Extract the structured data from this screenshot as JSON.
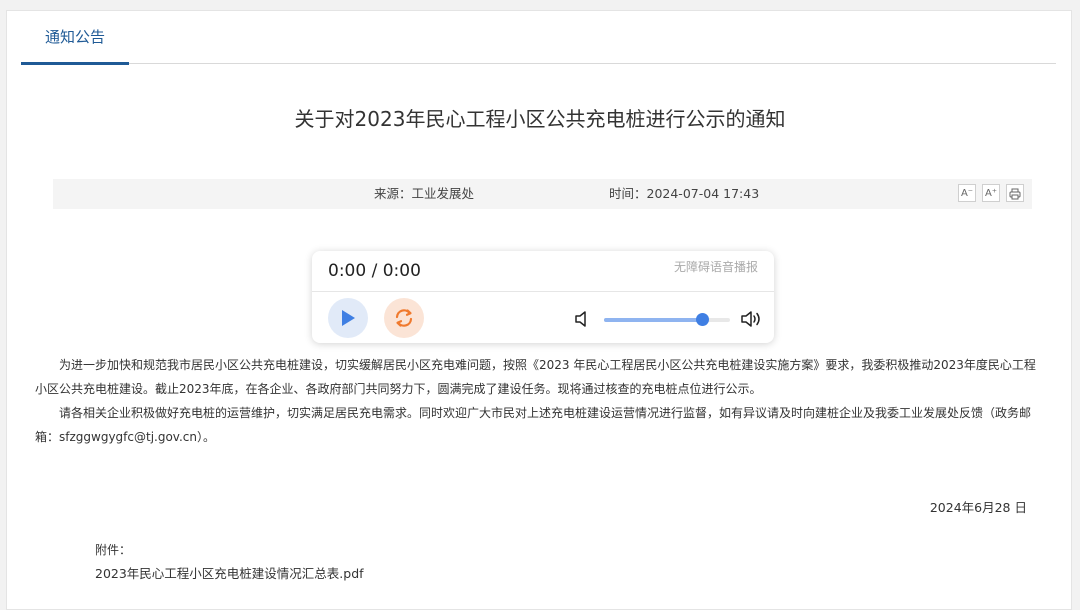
{
  "tab": {
    "label": "通知公告"
  },
  "article": {
    "title": "关于对2023年民心工程小区公共充电桩进行公示的通知",
    "source": "来源：工业发展处",
    "time": "时间：2024-07-04 17:43",
    "tools": {
      "decrease_font": "A⁻",
      "increase_font": "A⁺"
    },
    "paragraphs": [
      "为进一步加快和规范我市居民小区公共充电桩建设，切实缓解居民小区充电难问题，按照《2023 年民心工程居民小区公共充电桩建设实施方案》要求，我委积极推动2023年度民心工程小区公共充电桩建设。截止2023年底，在各企业、各政府部门共同努力下，圆满完成了建设任务。现将通过核查的充电桩点位进行公示。",
      "请各相关企业积极做好充电桩的运营维护，切实满足居民充电需求。同时欢迎广大市民对上述充电桩建设运营情况进行监督，如有异议请及时向建桩企业及我委工业发展处反馈（政务邮箱：sfzggwgygfc@tj.gov.cn）。"
    ],
    "date": "2024年6月28 日",
    "attachment_label": "附件：",
    "attachment_file": "2023年民心工程小区充电桩建设情况汇总表.pdf"
  },
  "player": {
    "timecode": "0:00 / 0:00",
    "a11y_label": "无障碍语音播报",
    "volume": 0.78,
    "colors": {
      "play_bg": "#e1eaf8",
      "play_icon": "#3f7fe3",
      "loop_bg": "#fbe4d6",
      "loop_icon": "#f07a2e"
    }
  },
  "colors": {
    "accent": "#1f5a96"
  }
}
